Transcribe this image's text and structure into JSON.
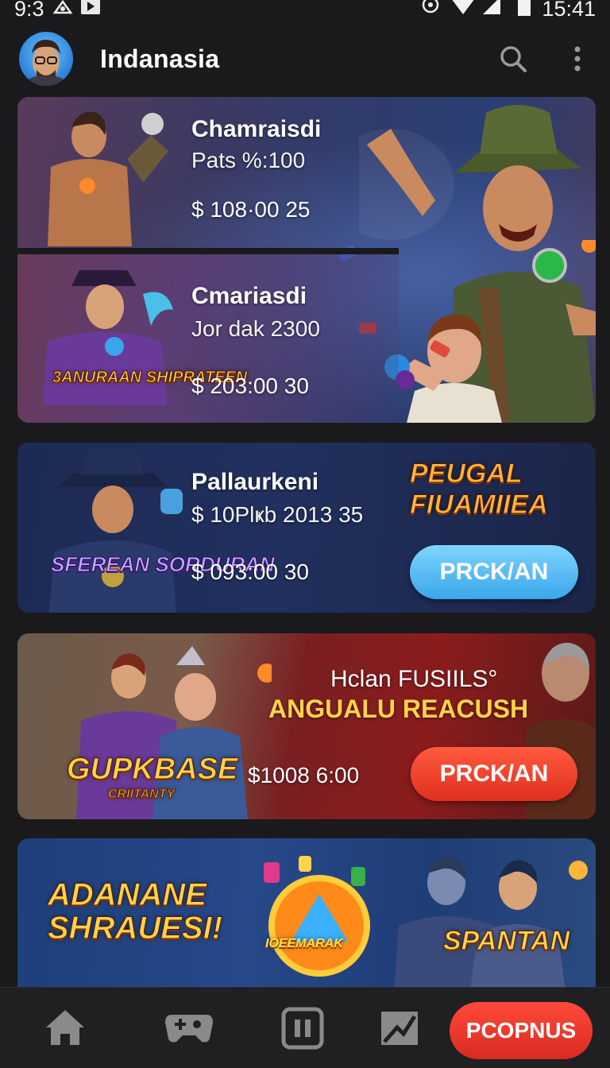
{
  "status_bar": {
    "time_left": "9:3",
    "time_right": "15:41"
  },
  "app_bar": {
    "title": "Indanasia",
    "icons": [
      "search-icon",
      "more-vertical-icon"
    ]
  },
  "cards": [
    {
      "title": "Chamraisdi",
      "subtitle": "Pats %:100",
      "price": "$ 108·00 25"
    },
    {
      "title": "Cmariasdi",
      "subtitle": "Jor dak 2300",
      "price": "$ 203:00 30",
      "logo": "3ANURAAN SHIPRATEEN"
    },
    {
      "title": "Pallaurkeni",
      "subtitle": "$ 10Plҝb 2013  35",
      "price": "$ 093:00 30",
      "logo_left": "SFEREAN SORDURAN",
      "logo_right": "PEUGAL FIUAMIIEA",
      "button": "PRCK/AN"
    },
    {
      "title": "Hclan FUSIILS°",
      "subtitle": "ANGUALU REACUSH",
      "price": "$1008 6:00",
      "logo": "GUPKBASE",
      "logo_sub": "CRIITANTY",
      "button": "PRCK/AN"
    },
    {
      "logo_left": "ADANANE SHRAUESI!",
      "logo_center": "IOEEMARAK",
      "logo_right": "SPANTAN"
    }
  ],
  "bottom_nav": {
    "items": [
      {
        "icon": "home-icon"
      },
      {
        "icon": "gamepad-icon"
      },
      {
        "icon": "pause-square-icon"
      },
      {
        "icon": "chart-icon"
      }
    ],
    "cta": "PCOPNUS"
  },
  "colors": {
    "background": "#1a1a1c",
    "blue_button": "#3aa6ea",
    "red_button": "#e0301e",
    "logo_gold": "#ffd34a"
  }
}
